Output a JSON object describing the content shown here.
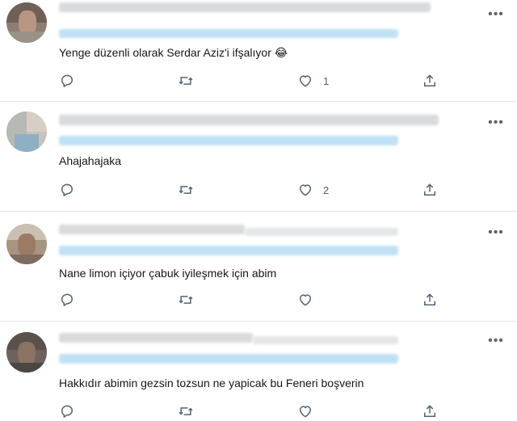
{
  "tweets": [
    {
      "text": "Yenge düzenli olarak Serdar Aziz'i ifşalıyor 😂",
      "likes": "1"
    },
    {
      "text": "Ahajahajaka",
      "likes": "2"
    },
    {
      "text": "Nane limon içiyor çabuk iyileşmek için abim",
      "likes": ""
    },
    {
      "text": "Hakkıdır abimin gezsin tozsun ne yapicak bu Feneri boşverin",
      "likes": ""
    }
  ],
  "icons": {
    "more": "more-dots-icon",
    "reply": "reply-icon",
    "retweet": "retweet-icon",
    "like": "like-icon",
    "share": "share-icon"
  },
  "colors": {
    "icon": "#536471",
    "text": "#14171a",
    "divider": "#dfe3e6",
    "mention_blur": "#bfe0f5"
  }
}
